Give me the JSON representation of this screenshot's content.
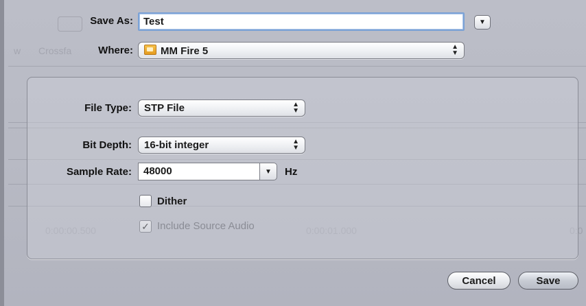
{
  "dialog": {
    "save_as_label": "Save As:",
    "save_as_value": "Test",
    "where_label": "Where:",
    "where_value": "MM Fire 5",
    "disclosure_symbol": "▼"
  },
  "options": {
    "file_type_label": "File Type:",
    "file_type_value": "STP File",
    "bit_depth_label": "Bit Depth:",
    "bit_depth_value": "16-bit integer",
    "sample_rate_label": "Sample Rate:",
    "sample_rate_value": "48000",
    "sample_rate_unit": "Hz",
    "dither_label": "Dither",
    "dither_checked": false,
    "include_source_label": "Include Source Audio",
    "include_source_checked": true,
    "include_source_enabled": false
  },
  "buttons": {
    "cancel_label": "Cancel",
    "save_label": "Save"
  },
  "background": {
    "timecode_1": "0:00:00.500",
    "timecode_2": "0:00:01.000",
    "timecode_3": "0:0",
    "crossfade_text": "Crossfa",
    "left_fragment": "w"
  },
  "icons": {
    "where_icon": "folder-icon",
    "popup_arrows": "up-down-arrows-icon",
    "combo_arrow": "chevron-down-icon",
    "checkmark": "checkmark-icon"
  }
}
